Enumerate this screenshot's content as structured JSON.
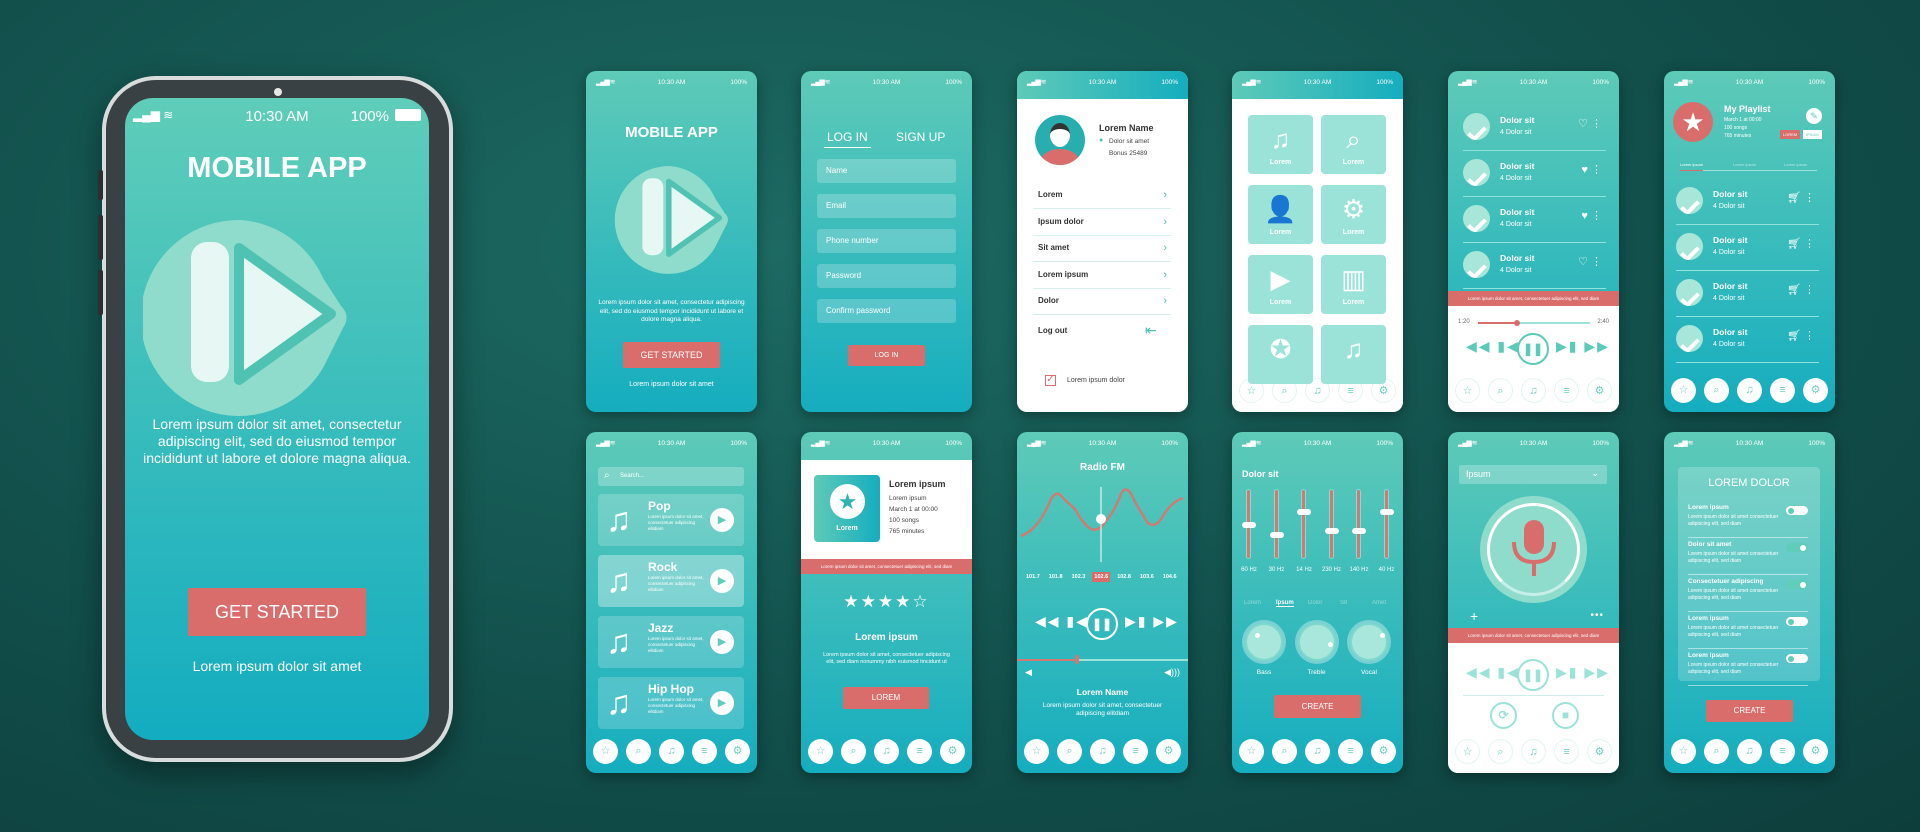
{
  "colors": {
    "accent": "#d96d6c",
    "teal_top": "#5ecab8",
    "teal_bottom": "#15adbf",
    "background": "#12504c"
  },
  "status": {
    "time": "10:30 AM",
    "battery": "100%"
  },
  "nav_icons": [
    "star-icon",
    "search-icon",
    "music-note-icon",
    "menu-icon",
    "gear-icon"
  ],
  "welcome": {
    "title": "MOBILE APP",
    "description": "Lorem ipsum dolor sit amet, consectetur adipiscing elit, sed do eiusmod tempor incididunt ut labore et dolore magna aliqua.",
    "button": "GET STARTED",
    "footer": "Lorem ipsum dolor sit amet"
  },
  "login": {
    "tab_login": "LOG IN",
    "tab_signup": "SIGN UP",
    "fields": [
      "Name",
      "Email",
      "Phone number",
      "Password",
      "Confirm password"
    ],
    "button": "LOG IN"
  },
  "profile": {
    "name": "Lorem Name",
    "location": "Dolor sit amet",
    "bonus": "Bonus 25489",
    "items": [
      "Lorem",
      "Ipsum dolor",
      "Sit amet",
      "Lorem ipsum",
      "Dolor"
    ],
    "logout": "Log out",
    "checkbox": "Lorem ipsum dolor"
  },
  "grid": {
    "tiles": [
      "Lorem",
      "Lorem",
      "Lorem",
      "Lorem",
      "Lorem",
      "Lorem"
    ]
  },
  "player": {
    "songs": [
      {
        "title": "Dolor sit",
        "sub": "4 Dolor sit",
        "liked": false
      },
      {
        "title": "Dolor sit",
        "sub": "4 Dolor sit",
        "liked": true
      },
      {
        "title": "Dolor sit",
        "sub": "4 Dolor sit",
        "liked": true
      },
      {
        "title": "Dolor sit",
        "sub": "4 Dolor sit",
        "liked": false
      }
    ],
    "banner": "Lorem ipsum dolor sit amet, consectetuer adipiscing elit, sed diam",
    "elapsed": "1:20",
    "total": "2:40",
    "progress": 0.35
  },
  "playlist": {
    "title": "My Playlist",
    "date": "March 1 at 00:00",
    "songs_count": "100 songs",
    "minutes": "765 minutes",
    "badge1": "LOREM",
    "badge2": "IPSUM",
    "tabs": [
      "Lorem ipsum",
      "Lorem ipsum",
      "Lorem ipsum"
    ],
    "songs": [
      {
        "title": "Dolor sit",
        "sub": "4 Dolor sit"
      },
      {
        "title": "Dolor sit",
        "sub": "4 Dolor sit"
      },
      {
        "title": "Dolor sit",
        "sub": "4 Dolor sit"
      },
      {
        "title": "Dolor sit",
        "sub": "4 Dolor sit"
      }
    ]
  },
  "genres": {
    "search_placeholder": "Search...",
    "items": [
      {
        "name": "Pop",
        "desc": "Lorem ipsum dolor sit amet, consectetuer adipiscing elitdiam"
      },
      {
        "name": "Rock",
        "desc": "Lorem ipsum dolor sit amet, consectetuer adipiscing elitdiam"
      },
      {
        "name": "Jazz",
        "desc": "Lorem ipsum dolor sit amet, consectetuer adipiscing elitdiam"
      },
      {
        "name": "Hip Hop",
        "desc": "Lorem ipsum dolor sit amet, consectetuer adipiscing elitdiam"
      }
    ]
  },
  "album": {
    "cover_label": "Lorem",
    "title": "Lorem ipsum",
    "sub": "Lorem ipsum",
    "date": "March 1 at 00:00",
    "songs": "100 songs",
    "minutes": "765 minutes",
    "banner": "Lorem ipsum dolor sit amet, consectetuer adipiscing elit, sed diam",
    "rating": 4,
    "rating_max": 5,
    "heading": "Lorem ipsum",
    "desc": "Lorem ipsum dolor sit amet, consectetuer adipiscing elit, sed diam nonummy nibh euismod tincidunt ut",
    "button": "LOREM"
  },
  "radio": {
    "title": "Radio FM",
    "frequencies": [
      "101.7",
      "101.8",
      "102.3",
      "102.6",
      "102.8",
      "103.6",
      "104.6"
    ],
    "selected": "102.6",
    "volume": 0.35,
    "name": "Lorem Name",
    "desc": "Lorem ipsum dolor sit amet, consectetuer adipiscing elitdiam"
  },
  "equalizer": {
    "title": "Dolor sit",
    "bands": [
      {
        "label": "60 Hz",
        "level": 0.5
      },
      {
        "label": "30 Hz",
        "level": 0.35
      },
      {
        "label": "14 Hz",
        "level": 0.7
      },
      {
        "label": "230 Hz",
        "level": 0.4
      },
      {
        "label": "140 Hz",
        "level": 0.4
      },
      {
        "label": "40 Hz",
        "level": 0.7
      }
    ],
    "tabs": [
      "Lorem",
      "Ipsum",
      "Dolor",
      "Sit",
      "Amet"
    ],
    "active_tab": "Ipsum",
    "knobs": [
      "Bass",
      "Treble",
      "Vocal"
    ],
    "button": "CREATE"
  },
  "recorder": {
    "dropdown": "Ipsum",
    "banner": "Lorem ipsum dolor sit amet, consectetuer adipiscing elit, sed diam"
  },
  "settings": {
    "title": "LOREM DOLOR",
    "rows": [
      {
        "title": "Lorem ipsum",
        "desc": "Lorem ipsum dolor sit amet consectetuer adipiscing elit, sed diam",
        "on": false
      },
      {
        "title": "Dolor sit amet",
        "desc": "Lorem ipsum dolor sit amet consectetuer adipiscing elit, sed diam",
        "on": true
      },
      {
        "title": "Consectetuer adipiscing",
        "desc": "Lorem ipsum dolor sit amet consectetuer adipiscing elit, sed diam",
        "on": true
      },
      {
        "title": "Lorem ipsum",
        "desc": "Lorem ipsum dolor sit amet consectetuer adipiscing elit, sed diam",
        "on": false
      },
      {
        "title": "Lorem ipsum",
        "desc": "Lorem ipsum dolor sit amet consectetuer adipiscing elit, sed diam",
        "on": false
      }
    ],
    "button": "CREATE"
  }
}
